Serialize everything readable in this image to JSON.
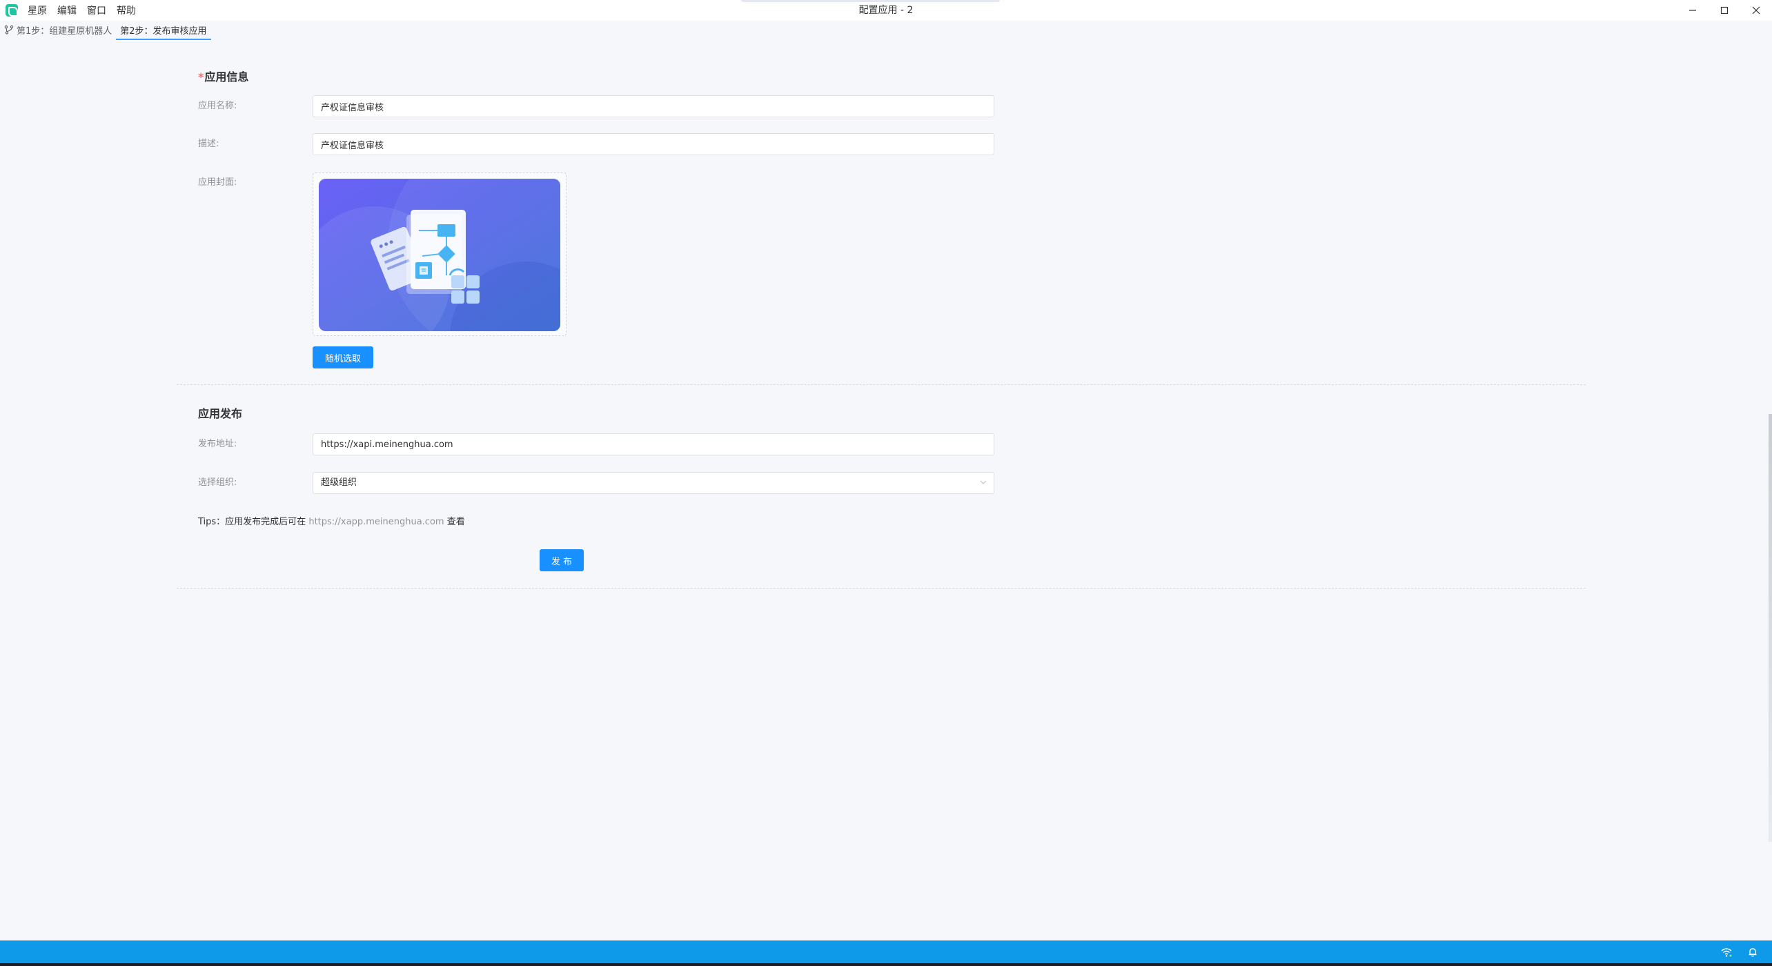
{
  "titlebar": {
    "menu": [
      "星原",
      "编辑",
      "窗口",
      "帮助"
    ],
    "window_title": "配置应用 - 2"
  },
  "tabs": [
    {
      "label": "第1步：组建星原机器人",
      "active": false
    },
    {
      "label": "第2步：发布审核应用",
      "active": true
    }
  ],
  "app_info": {
    "title": "应用信息",
    "required_mark": "*",
    "name_label": "应用名称:",
    "name_value": "产权证信息审核",
    "desc_label": "描述:",
    "desc_value": "产权证信息审核",
    "cover_label": "应用封面:",
    "random_button": "随机选取"
  },
  "app_publish": {
    "title": "应用发布",
    "address_label": "发布地址:",
    "address_value": "https://xapi.meinenghua.com",
    "org_label": "选择组织:",
    "org_value": "超级组织",
    "tips_prefix": "Tips：应用发布完成后可在",
    "tips_link": "https://xapp.meinenghua.com",
    "tips_suffix": "查看",
    "publish_button": "发 布"
  },
  "colors": {
    "primary": "#1890ff",
    "statusbar": "#0e9ae8",
    "required": "#f56c6c",
    "cover_gradient_start": "#6b62f6",
    "cover_gradient_end": "#3f6fd8"
  },
  "icons": {
    "app_logo": "app-logo-icon",
    "branch": "branch-icon",
    "select_arrow": "chevron-down-icon",
    "wifi": "wifi-icon",
    "bell": "bell-icon"
  }
}
